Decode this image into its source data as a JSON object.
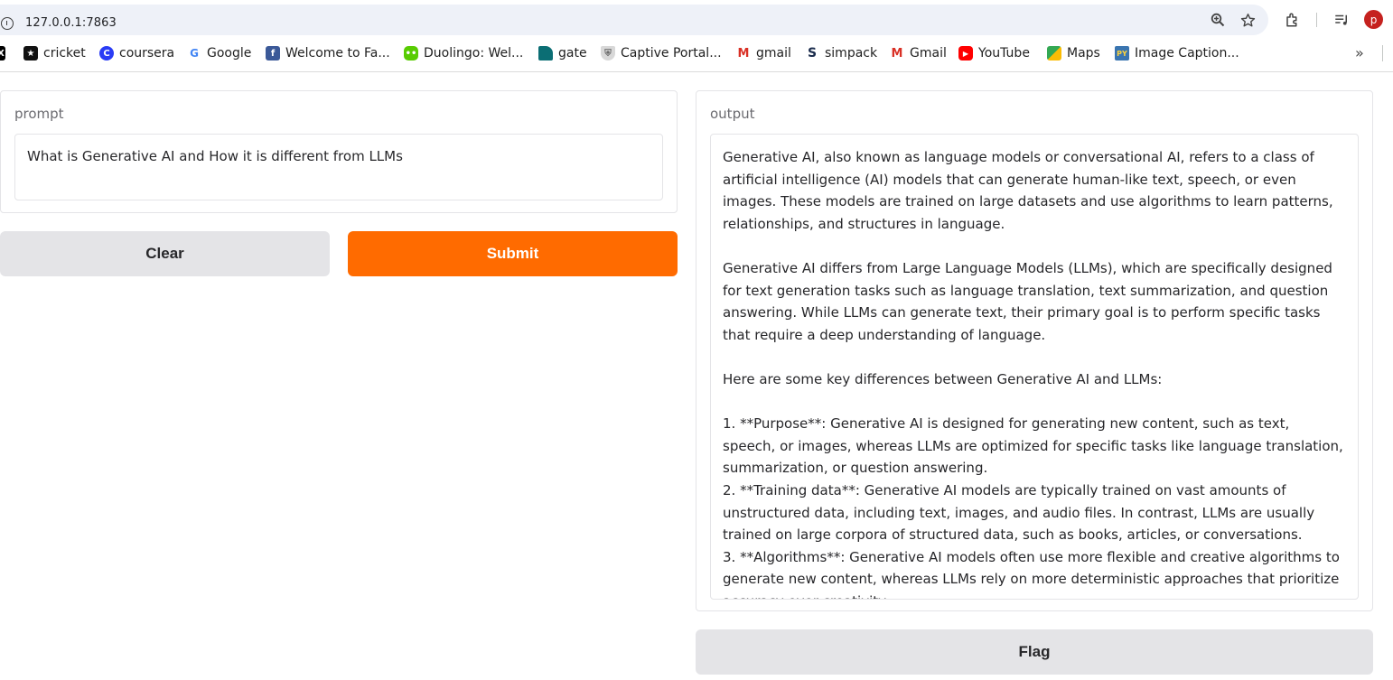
{
  "browser": {
    "url": "127.0.0.1:7863",
    "bookmarks": [
      {
        "label": "cricket",
        "icon": "x-logo-icon"
      },
      {
        "label": "coursera",
        "icon": "coursera-icon"
      },
      {
        "label": "Google",
        "icon": "google-icon"
      },
      {
        "label": "Welcome to Fa...",
        "icon": "facebook-icon"
      },
      {
        "label": "Duolingo: Wel...",
        "icon": "duolingo-icon"
      },
      {
        "label": "gate",
        "icon": "gate-icon"
      },
      {
        "label": "Captive Portal...",
        "icon": "shield-icon"
      },
      {
        "label": "gmail",
        "icon": "gmail-icon"
      },
      {
        "label": "simpack",
        "icon": "simpack-icon"
      },
      {
        "label": "Gmail",
        "icon": "gmail-icon"
      },
      {
        "label": "YouTube",
        "icon": "youtube-icon"
      },
      {
        "label": "Maps",
        "icon": "maps-icon"
      },
      {
        "label": "Image Caption...",
        "icon": "python-icon"
      }
    ],
    "profile_initial": "p"
  },
  "app": {
    "prompt": {
      "label": "prompt",
      "value": "What is Generative AI and How it is different from LLMs"
    },
    "buttons": {
      "clear": "Clear",
      "submit": "Submit",
      "flag": "Flag"
    },
    "output": {
      "label": "output",
      "value": "Generative AI, also known as language models or conversational AI, refers to a class of artificial intelligence (AI) models that can generate human-like text, speech, or even images. These models are trained on large datasets and use algorithms to learn patterns, relationships, and structures in language.\n\nGenerative AI differs from Large Language Models (LLMs), which are specifically designed for text generation tasks such as language translation, text summarization, and question answering. While LLMs can generate text, their primary goal is to perform specific tasks that require a deep understanding of language.\n\nHere are some key differences between Generative AI and LLMs:\n\n1. **Purpose**: Generative AI is designed for generating new content, such as text, speech, or images, whereas LLMs are optimized for specific tasks like language translation, summarization, or question answering.\n2. **Training data**: Generative AI models are typically trained on vast amounts of unstructured data, including text, images, and audio files. In contrast, LLMs are usually trained on large corpora of structured data, such as books, articles, or conversations.\n3. **Algorithms**: Generative AI models often use more flexible and creative algorithms to generate new content, whereas LLMs rely on more deterministic approaches that prioritize accuracy over creativity."
    }
  },
  "colors": {
    "primary": "#ff6b00",
    "secondary": "#e4e4e7"
  }
}
